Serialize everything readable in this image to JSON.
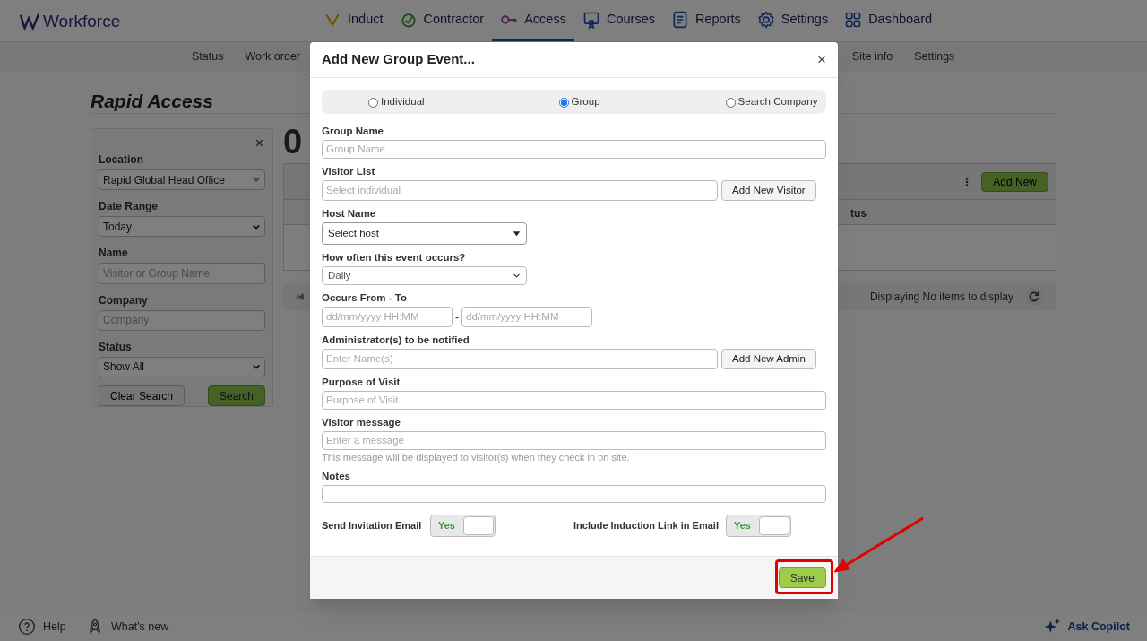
{
  "app": {
    "logo": "Workforce"
  },
  "nav": [
    {
      "label": "Induct",
      "kind": "induct",
      "selected": false
    },
    {
      "label": "Contractor",
      "kind": "contractor",
      "selected": false
    },
    {
      "label": "Access",
      "kind": "access",
      "selected": true
    },
    {
      "label": "Courses",
      "kind": "courses",
      "selected": false
    },
    {
      "label": "Reports",
      "kind": "reports",
      "selected": false
    },
    {
      "label": "Settings",
      "kind": "settings",
      "selected": false
    },
    {
      "label": "Dashboard",
      "kind": "dashboard",
      "selected": false
    }
  ],
  "subnav_left": [
    "Status",
    "Work order"
  ],
  "subnav_right": [
    "Site info",
    "Settings"
  ],
  "page": {
    "title": "Rapid Access",
    "count": "0"
  },
  "filter": {
    "fields": [
      {
        "label": "Location",
        "kind": "combo",
        "value": "Rapid Global Head Office"
      },
      {
        "label": "Date Range",
        "kind": "select",
        "value": "Today"
      },
      {
        "label": "Name",
        "kind": "text",
        "placeholder": "Visitor or Group Name"
      },
      {
        "label": "Company",
        "kind": "text",
        "placeholder": "Company"
      },
      {
        "label": "Status",
        "kind": "select",
        "value": "Show All"
      }
    ],
    "clear_button": "Clear Search",
    "search_button": "Search"
  },
  "filter_close": "×",
  "modal_close": "×",
  "grid": {
    "add_button": "Add New",
    "column_3": "tus",
    "pager_text": "Displaying No items to display"
  },
  "footer": {
    "help": "Help",
    "whats_new": "What's new",
    "copilot": "Ask Copilot"
  },
  "modal": {
    "title": "Add New Group Event...",
    "modes": [
      {
        "label": "Individual",
        "selected": false
      },
      {
        "label": "Group",
        "selected": true
      },
      {
        "label": "Search Company",
        "selected": false
      }
    ],
    "group_name": {
      "label": "Group Name",
      "placeholder": "Group Name"
    },
    "visitor_list": {
      "label": "Visitor List",
      "placeholder": "Select individual",
      "button": "Add New Visitor"
    },
    "host": {
      "label": "Host Name",
      "value": "Select host"
    },
    "frequency": {
      "label": "How often this event occurs?",
      "value": "Daily"
    },
    "occurs": {
      "label": "Occurs From - To",
      "from_placeholder": "dd/mm/yyyy HH:MM",
      "separator": "-",
      "to_placeholder": "dd/mm/yyyy HH:MM"
    },
    "admins": {
      "label": "Administrator(s) to be notified",
      "placeholder": "Enter Name(s)",
      "button": "Add New Admin"
    },
    "purpose": {
      "label": "Purpose of Visit",
      "placeholder": "Purpose of Visit"
    },
    "message": {
      "label": "Visitor message",
      "placeholder": "Enter a message",
      "hint": "This message will be displayed to visitor(s) when they check in on site."
    },
    "notes": {
      "label": "Notes"
    },
    "toggles": [
      {
        "label": "Send Invitation Email",
        "text": "Yes",
        "on": true
      },
      {
        "label": "Include Induction Link in Email",
        "text": "Yes",
        "on": true
      }
    ],
    "save_button": "Save"
  }
}
